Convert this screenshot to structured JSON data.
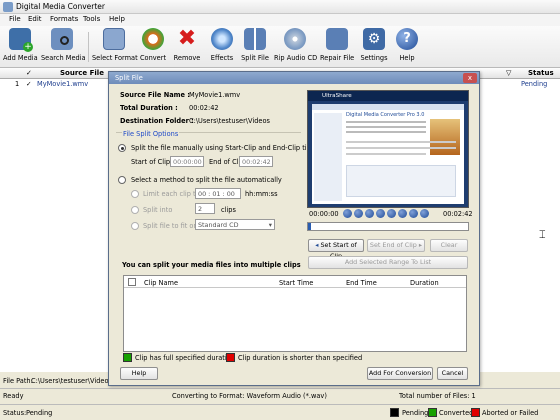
{
  "app": {
    "title": "Digital Media Converter"
  },
  "menu": [
    "File",
    "Edit",
    "Formats",
    "Tools",
    "Help"
  ],
  "toolbar": [
    {
      "label": "Add Media",
      "icon": "add-media-icon"
    },
    {
      "label": "Search Media",
      "icon": "search-media-icon"
    },
    {
      "label": "Select Format",
      "icon": "select-format-icon"
    },
    {
      "label": "Convert",
      "icon": "convert-icon"
    },
    {
      "label": "Remove",
      "icon": "remove-icon"
    },
    {
      "label": "Effects",
      "icon": "effects-icon"
    },
    {
      "label": "Split File",
      "icon": "split-file-icon"
    },
    {
      "label": "Rip Audio CD",
      "icon": "rip-audio-cd-icon"
    },
    {
      "label": "Repair File",
      "icon": "repair-file-icon"
    },
    {
      "label": "Settings",
      "icon": "settings-icon"
    },
    {
      "label": "Help",
      "icon": "help-icon"
    }
  ],
  "file_table": {
    "headers": {
      "source": "Source File",
      "status": "Status"
    },
    "row": {
      "num": "1",
      "name": "MyMovie1.wmv",
      "status": "Pending"
    }
  },
  "file_path": {
    "label": "File Path:",
    "value": "C:\\Users\\testuser\\Videos\\M"
  },
  "convert_bar": {
    "ready": "Ready",
    "format": "Converting to Format: Waveform Audio (*.wav)",
    "total": "Total number of Files: 1"
  },
  "status_bar": {
    "label": "Status:",
    "value": "Pending",
    "legend": [
      "Pending",
      "Converted",
      "Aborted or Failed"
    ]
  },
  "colors": {
    "pending": "#000000",
    "converted": "#17a000",
    "failed": "#e00000",
    "accent": "#1f4a96"
  },
  "dialog": {
    "title": "Split File",
    "close": "x",
    "source_label": "Source File Name :",
    "source_value": "MyMovie1.wmv",
    "duration_label": "Total Duration :",
    "duration_value": "00:02:42",
    "dest_label": "Destination Folder :",
    "dest_value": "C:\\Users\\testuser\\Videos",
    "options_title": "File Split Options",
    "manual_label": "Split the file manually using Start-Clip and End-Clip times.",
    "start_clip_label": "Start of Clip",
    "start_clip_value": "00:00:00",
    "end_clip_label": "End of Clip",
    "end_clip_value": "00:02:42",
    "auto_label": "Select a method to split the file automatically",
    "limit_label": "Limit each clip to",
    "limit_value": "00 : 01 : 00",
    "limit_unit": "hh:mm:ss",
    "split_into_label": "Split into",
    "split_into_value": "2",
    "clips_unit": "clips",
    "fit_label": "Split file to fit on",
    "fit_value": "Standard CD",
    "time_start": "00:00:00",
    "time_end": "00:02:42",
    "set_start": "Set Start of Clip",
    "set_end": "Set End of Clip",
    "clear": "Clear",
    "add_range": "Add Selected Range To List",
    "info": "You can split your media files into multiple clips",
    "clip_cols": [
      "Clip Name",
      "Start Time",
      "End Time",
      "Duration"
    ],
    "legend_full": "Clip has full specified duration",
    "legend_short": "Clip duration is shorter than specified",
    "help": "Help",
    "add_conversion": "Add For Conversion",
    "cancel": "Cancel",
    "video": {
      "site_name": "UltraShare",
      "page_title": "Digital Media Converter Pro 3.0"
    }
  }
}
